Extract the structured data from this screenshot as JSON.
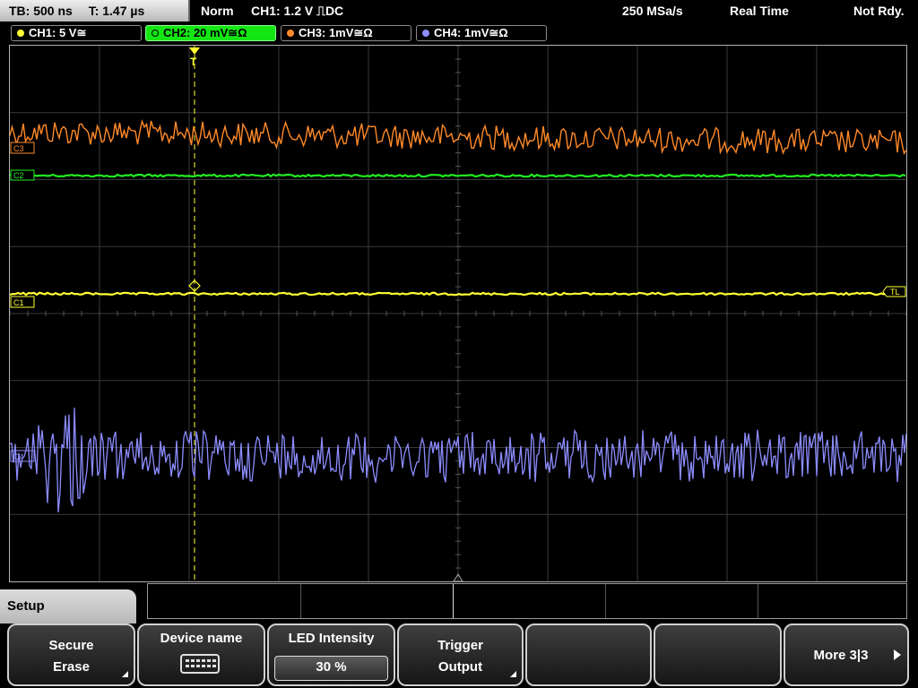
{
  "topbar": {
    "timebase": "TB: 500 ns",
    "trigger_time": "T: 1.47 µs",
    "mode": "Norm",
    "trigger_info": "CH1: 1.2 V ⎍DC",
    "sample_rate": "250 MSa/s",
    "acquisition": "Real Time",
    "status": "Not Rdy."
  },
  "channels": [
    {
      "label": "CH1: 5 V≅",
      "color": "#ffff33",
      "active": false
    },
    {
      "label": "CH2: 20 mV≅Ω",
      "color": "#22ee22",
      "active": true
    },
    {
      "label": "CH3: 1mV≅Ω",
      "color": "#ff8a2a",
      "active": false
    },
    {
      "label": "CH4: 1mV≅Ω",
      "color": "#8c8cff",
      "active": false
    }
  ],
  "markers": {
    "c1": "C1",
    "c2": "C2",
    "c3": "C3",
    "c4": "C4",
    "trigger_level": "TL",
    "trigger_pos": "T"
  },
  "menu": {
    "title": "Setup",
    "secure_erase": [
      "Secure",
      "Erase"
    ],
    "device_name": "Device name",
    "led_intensity": "LED Intensity",
    "led_value": "30 %",
    "trigger_output": [
      "Trigger",
      "Output"
    ],
    "more": "More 3|3"
  },
  "icons": {
    "keyboard": "keyboard-icon",
    "more": "arrow-right-icon",
    "submenu": "submenu-corner-icon"
  }
}
